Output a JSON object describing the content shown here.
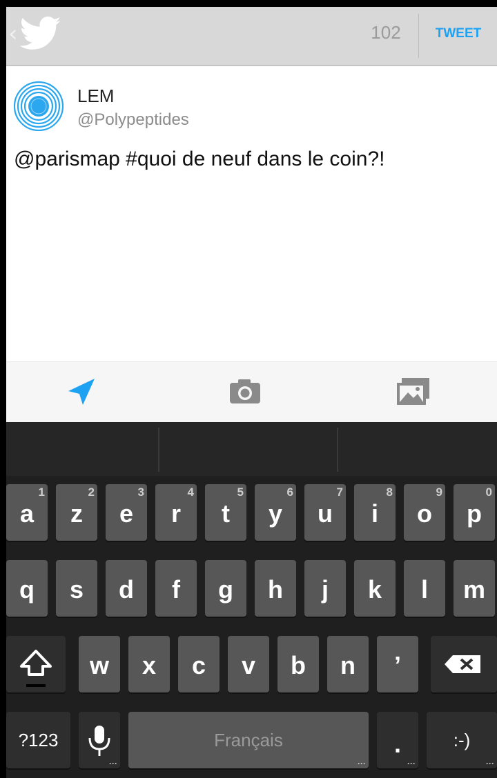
{
  "header": {
    "char_count": "102",
    "tweet_label": "TWEET",
    "back_glyph": "‹"
  },
  "user": {
    "name": "LEM",
    "handle": "@Polypeptides"
  },
  "compose": {
    "text": "@parismap #quoi de neuf dans le coin?!"
  },
  "toolbar": {
    "icons": [
      "location-arrow-icon",
      "camera-icon",
      "gallery-icon"
    ]
  },
  "keyboard": {
    "row1": [
      {
        "key": "a",
        "hint": "1"
      },
      {
        "key": "z",
        "hint": "2"
      },
      {
        "key": "e",
        "hint": "3"
      },
      {
        "key": "r",
        "hint": "4"
      },
      {
        "key": "t",
        "hint": "5"
      },
      {
        "key": "y",
        "hint": "6"
      },
      {
        "key": "u",
        "hint": "7"
      },
      {
        "key": "i",
        "hint": "8"
      },
      {
        "key": "o",
        "hint": "9"
      },
      {
        "key": "p",
        "hint": "0"
      }
    ],
    "row2": [
      "q",
      "s",
      "d",
      "f",
      "g",
      "h",
      "j",
      "k",
      "l",
      "m"
    ],
    "row3": [
      "w",
      "x",
      "c",
      "v",
      "b",
      "n",
      "’"
    ],
    "symbols_label": "?123",
    "space_label": "Français",
    "period_label": ".",
    "emoticon_label": ":-)"
  },
  "colors": {
    "accent": "#1da1f2",
    "actionbar": "#d8d8d8",
    "key": "#575757",
    "keyboard_bg": "#1f1f1f"
  }
}
